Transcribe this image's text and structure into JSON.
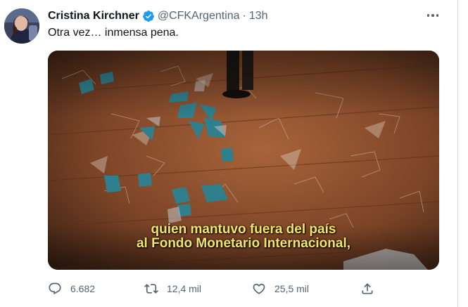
{
  "tweet": {
    "author_name": "Cristina Kirchner",
    "handle": "@CFKArgentina",
    "separator": "·",
    "time": "13h",
    "text": "Otra vez… inmensa pena.",
    "verified_color": "#1d9bf0"
  },
  "media": {
    "caption_line1": "quien mantuvo fuera del país",
    "caption_line2": "al Fondo Monetario Internacional,"
  },
  "actions": {
    "replies": "6.682",
    "retweets": "12,4 mil",
    "likes": "25,5 mil"
  },
  "icons": [
    "verified-badge-icon",
    "more-options-icon",
    "reply-icon",
    "retweet-icon",
    "like-icon",
    "share-icon"
  ]
}
